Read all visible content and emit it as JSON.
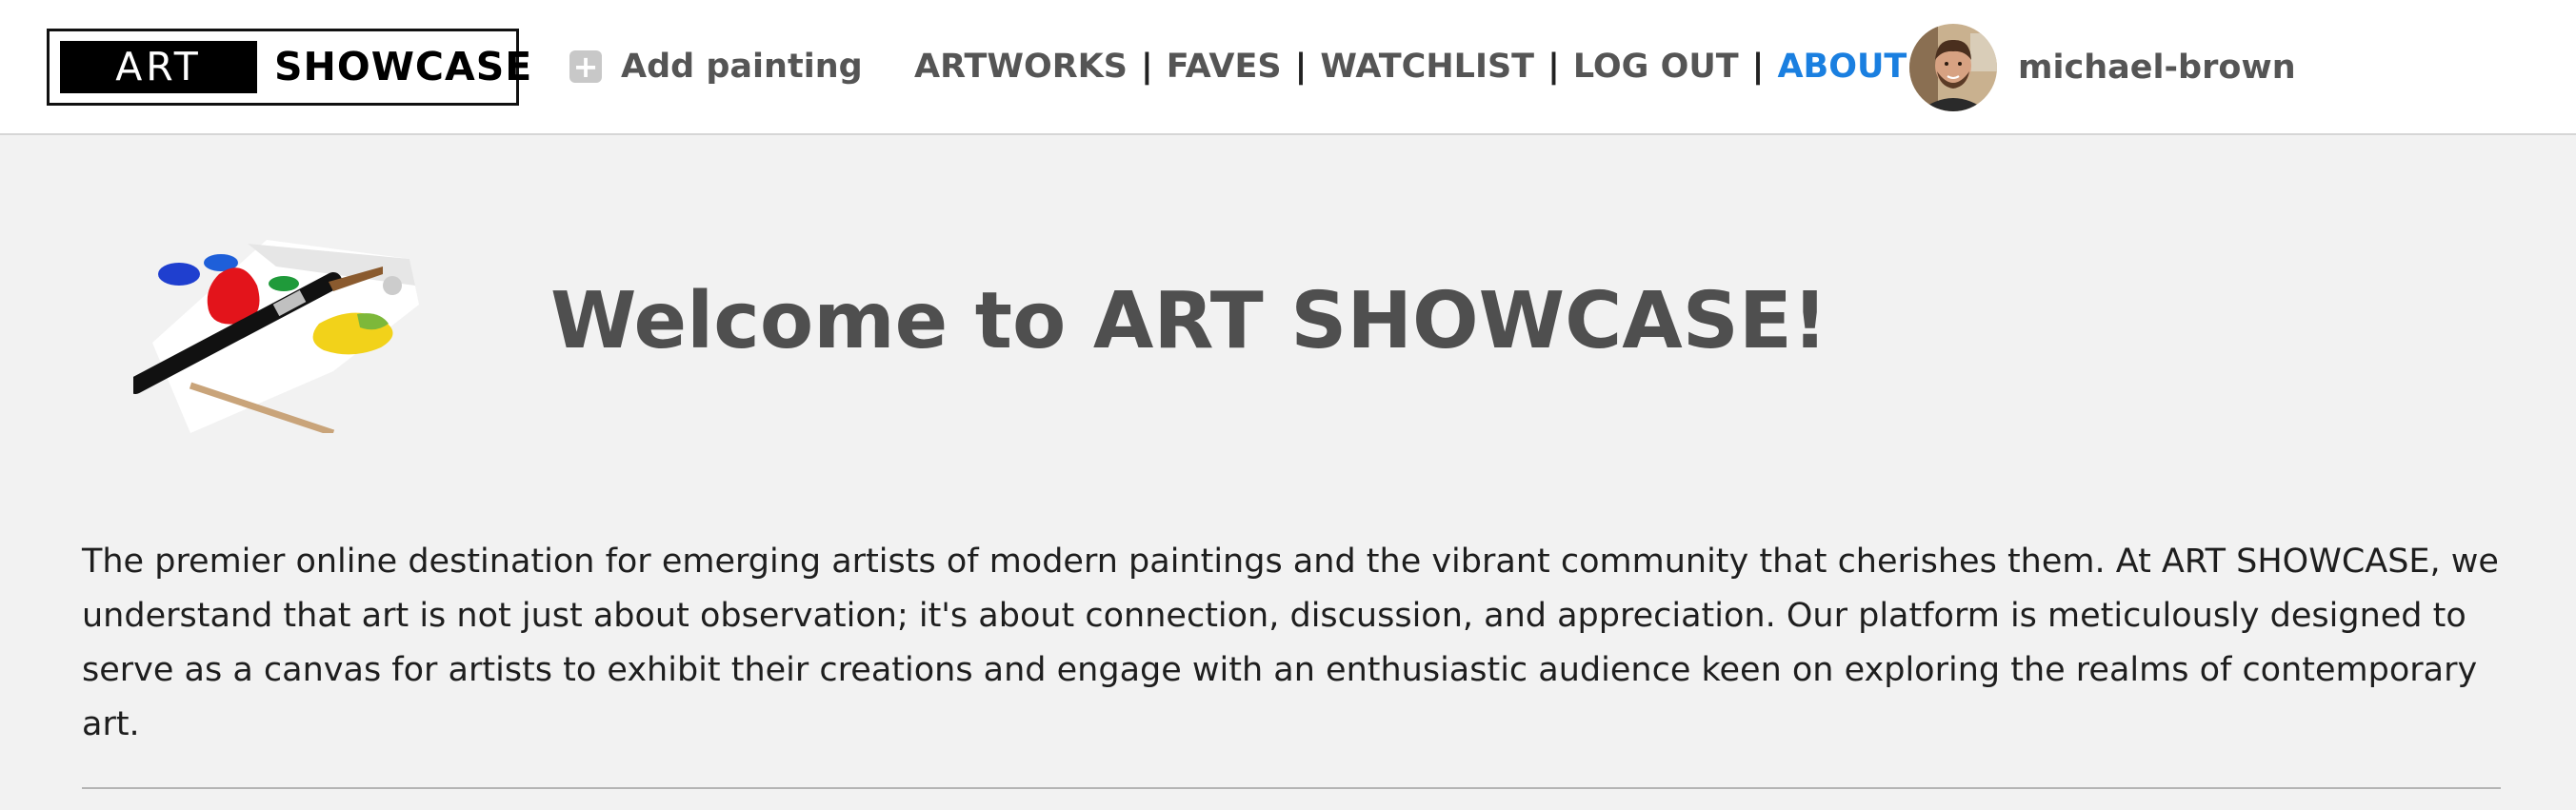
{
  "logo": {
    "art": "ART",
    "showcase": "SHOWCASE"
  },
  "header": {
    "add_painting_label": "Add painting",
    "add_icon": "plus-square-icon",
    "nav": [
      {
        "label": "ARTWORKS"
      },
      {
        "label": "FAVES"
      },
      {
        "label": "WATCHLIST"
      },
      {
        "label": "LOG OUT"
      },
      {
        "label": "ABOUT",
        "active": true
      }
    ],
    "separator": "|",
    "username": "michael-brown",
    "avatar_icon": "user-avatar-photo"
  },
  "main": {
    "title": "Welcome to ART SHOWCASE!",
    "intro": "The premier online destination for emerging artists of modern paintings and the vibrant community that cherishes them. At ART SHOWCASE, we understand that art is not just about observation; it's about connection, discussion, and appreciation. Our platform is meticulously designed to serve as a canvas for artists to exhibit their creations and engage with an enthusiastic audience keen on exploring the realms of contemporary art.",
    "illustration": "paint-palette-with-brush"
  },
  "colors": {
    "accent": "#1a7fe0",
    "nav_text": "#555555",
    "title_text": "#4f4f4f",
    "background": "#f2f2f2",
    "header_bg": "#ffffff"
  }
}
